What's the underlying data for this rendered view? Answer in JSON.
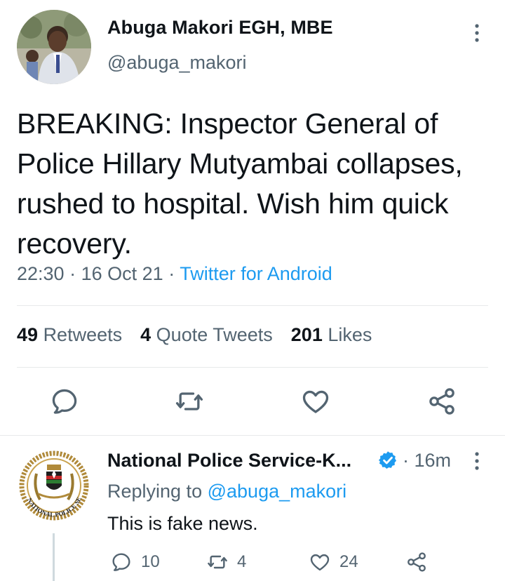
{
  "tweet": {
    "author_name": "Abuga Makori EGH, MBE",
    "author_handle": "@abuga_makori",
    "text": "BREAKING: Inspector General of Police Hillary Mutyambai collapses, rushed to hospital. Wish him quick recovery.",
    "time": "22:30",
    "date": "16 Oct 21",
    "separator": "·",
    "source": "Twitter for Android",
    "stats": {
      "retweets_count": "49",
      "retweets_label": "Retweets",
      "quotes_count": "4",
      "quotes_label": "Quote Tweets",
      "likes_count": "201",
      "likes_label": "Likes"
    },
    "actions": [
      "reply-icon",
      "retweet-icon",
      "like-icon",
      "share-icon"
    ]
  },
  "reply": {
    "author_name": "National Police Service-K...",
    "verified": true,
    "separator": "·",
    "time": "16m",
    "replying_prefix": "Replying to",
    "replying_handle": "@abuga_makori",
    "text": "This is fake news.",
    "seal_text": "NATIONAL POLICE SERVICE",
    "counts": {
      "replies": "10",
      "retweets": "4",
      "likes": "24"
    }
  },
  "colors": {
    "accent": "#1d9bf0",
    "text": "#0f1419",
    "secondary": "#536471",
    "divider": "#e7e9ea",
    "icon": "#536471"
  }
}
